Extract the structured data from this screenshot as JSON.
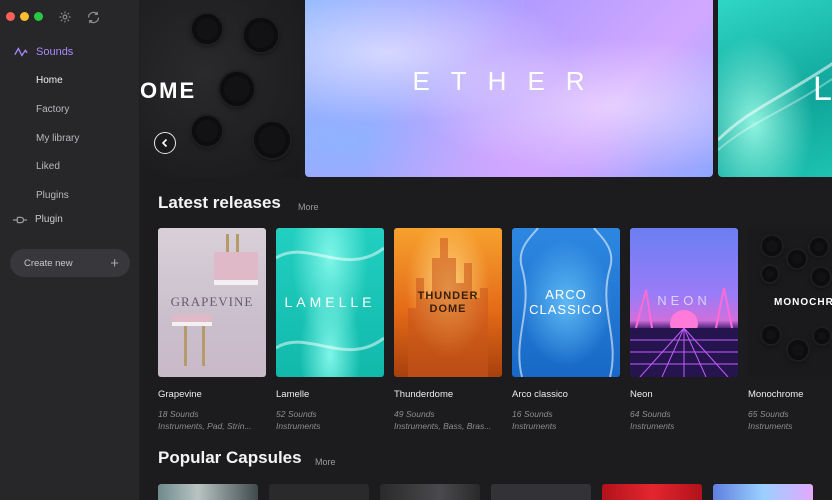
{
  "sidebar": {
    "section_label": "Sounds",
    "items": [
      {
        "label": "Home",
        "active": true
      },
      {
        "label": "Factory",
        "active": false
      },
      {
        "label": "My library",
        "active": false
      },
      {
        "label": "Liked",
        "active": false
      },
      {
        "label": "Plugins",
        "active": false
      }
    ],
    "plugin_label": "Plugin",
    "create_new_label": "Create new"
  },
  "hero": {
    "left_title": "OME",
    "main_title": "ETHER",
    "right_title": "L"
  },
  "latest": {
    "title": "Latest releases",
    "more_label": "More",
    "cards": [
      {
        "art_title": "GRAPEVINE",
        "name": "Grapevine",
        "count": "18 Sounds",
        "tags": "Instruments, Pad, Strin..."
      },
      {
        "art_title": "LAMELLE",
        "name": "Lamelle",
        "count": "52 Sounds",
        "tags": "Instruments"
      },
      {
        "art_title": "THUNDER DOME",
        "name": "Thunderdome",
        "count": "49 Sounds",
        "tags": "Instruments, Bass, Bras..."
      },
      {
        "art_title": "ARCO CLASSICO",
        "name": "Arco classico",
        "count": "16 Sounds",
        "tags": "Instruments"
      },
      {
        "art_title": "NEON",
        "name": "Neon",
        "count": "64 Sounds",
        "tags": "Instruments"
      },
      {
        "art_title": "MONOCHROM",
        "name": "Monochrome",
        "count": "65 Sounds",
        "tags": "Instruments"
      }
    ]
  },
  "popular": {
    "title": "Popular Capsules",
    "more_label": "More"
  },
  "colors": {
    "accent": "#a78bfa",
    "sidebar_bg": "#27272a",
    "main_bg": "#1c1c1e"
  }
}
